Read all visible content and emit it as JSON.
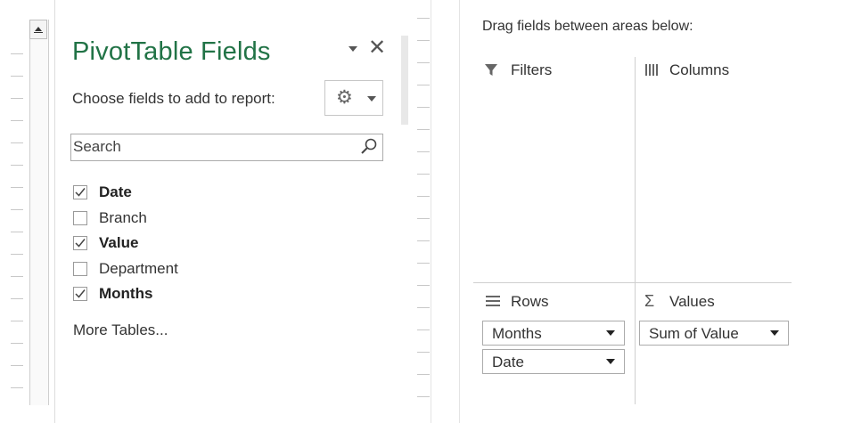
{
  "pane": {
    "title": "PivotTable Fields",
    "choose_label": "Choose fields to add to report:",
    "search_placeholder": "Search",
    "more_tables": "More Tables..."
  },
  "fields": [
    {
      "label": "Date",
      "checked": true,
      "bold": true
    },
    {
      "label": "Branch",
      "checked": false,
      "bold": false
    },
    {
      "label": "Value",
      "checked": true,
      "bold": true
    },
    {
      "label": "Department",
      "checked": false,
      "bold": false
    },
    {
      "label": "Months",
      "checked": true,
      "bold": true
    }
  ],
  "areas": {
    "hint": "Drag fields between areas below:",
    "filters": {
      "label": "Filters",
      "icon": "filter-icon"
    },
    "columns": {
      "label": "Columns",
      "icon": "columns-icon"
    },
    "rows": {
      "label": "Rows",
      "icon": "rows-icon",
      "items": [
        "Months",
        "Date"
      ]
    },
    "values": {
      "label": "Values",
      "icon": "sigma-icon",
      "items": [
        "Sum of Value"
      ]
    }
  },
  "colors": {
    "title_green": "#217346"
  }
}
